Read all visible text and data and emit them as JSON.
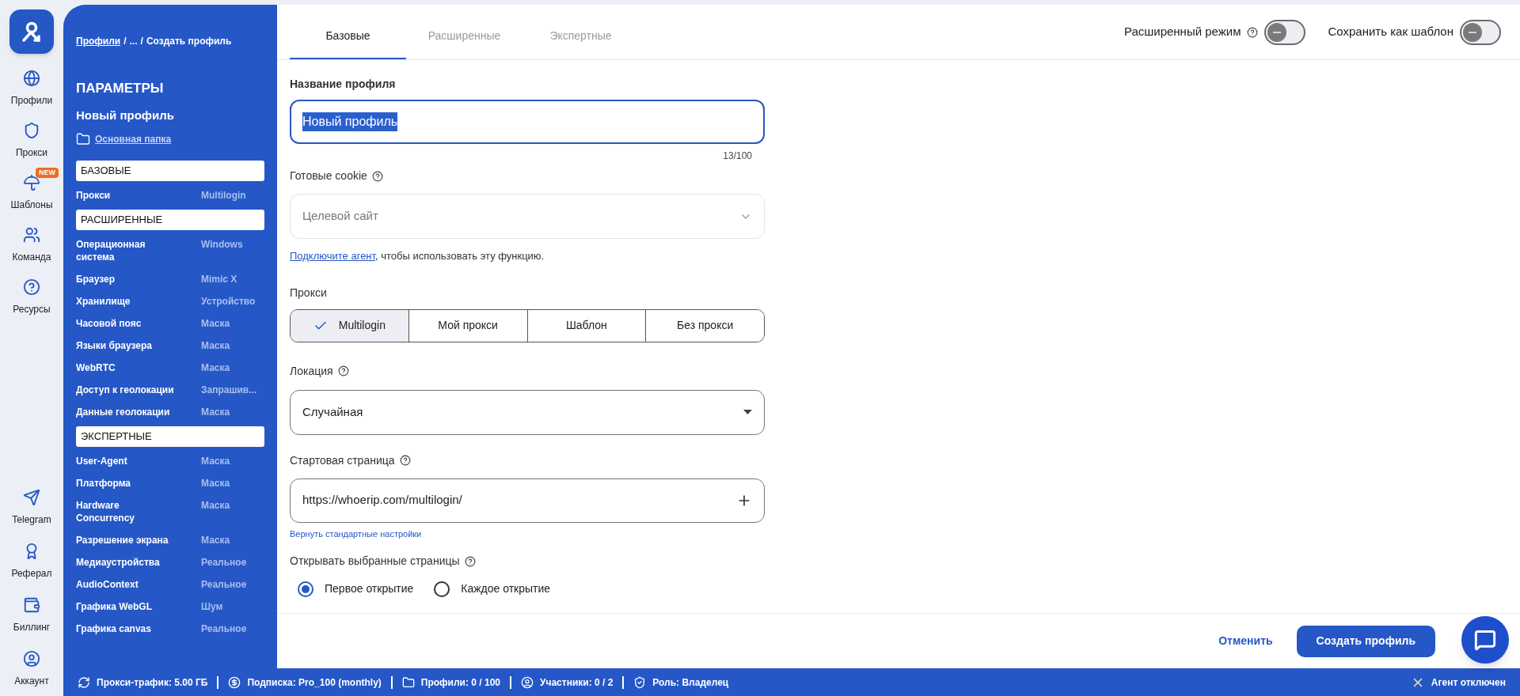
{
  "rail": {
    "items": [
      {
        "label": "Профили"
      },
      {
        "label": "Прокси"
      },
      {
        "label": "Шаблоны",
        "badge": "NEW"
      },
      {
        "label": "Команда"
      },
      {
        "label": "Ресурсы"
      }
    ],
    "bottom_items": [
      {
        "label": "Telegram"
      },
      {
        "label": "Реферал"
      },
      {
        "label": "Биллинг"
      },
      {
        "label": "Аккаунт"
      }
    ]
  },
  "sidebar": {
    "breadcrumb": {
      "separator": "/",
      "crumbs": [
        {
          "label": "Профили",
          "link": true
        },
        {
          "label": "...",
          "link": false
        },
        {
          "label": "Создать профиль",
          "link": false
        }
      ]
    },
    "title": "ПАРАМЕТРЫ",
    "profile_name": "Новый профиль",
    "folder": "Основная папка",
    "sections": [
      {
        "title": "БАЗОВЫЕ",
        "rows": [
          {
            "name": "Прокси",
            "value": "Multilogin"
          }
        ]
      },
      {
        "title": "РАСШИРЕННЫЕ",
        "rows": [
          {
            "name": "Операционная система",
            "value": "Windows"
          },
          {
            "name": "Браузер",
            "value": "Mimic X"
          },
          {
            "name": "Хранилище",
            "value": "Устройство"
          },
          {
            "name": "Часовой пояс",
            "value": "Маска"
          },
          {
            "name": "Языки браузера",
            "value": "Маска"
          },
          {
            "name": "WebRTC",
            "value": "Маска"
          },
          {
            "name": "Доступ к геолокации",
            "value": "Запрашив..."
          },
          {
            "name": "Данные геолокации",
            "value": "Маска"
          }
        ]
      },
      {
        "title": "ЭКСПЕРТНЫЕ",
        "rows": [
          {
            "name": "User-Agent",
            "value": "Маска"
          },
          {
            "name": "Платформа",
            "value": "Маска"
          },
          {
            "name": "Hardware Concurrency",
            "value": "Маска"
          },
          {
            "name": "Разрешение экрана",
            "value": "Маска"
          },
          {
            "name": "Медиаустройства",
            "value": "Реальное"
          },
          {
            "name": "AudioContext",
            "value": "Реальное"
          },
          {
            "name": "Графика WebGL",
            "value": "Шум"
          },
          {
            "name": "Графика canvas",
            "value": "Реальное"
          }
        ]
      }
    ]
  },
  "tabs": [
    {
      "label": "Базовые",
      "selected": true
    },
    {
      "label": "Расширенные",
      "selected": false
    },
    {
      "label": "Экспертные",
      "selected": false
    }
  ],
  "toggles": [
    {
      "label": "Расширенный режим",
      "help": true,
      "on": false
    },
    {
      "label": "Сохранить как шаблон",
      "help": false,
      "on": false
    }
  ],
  "form": {
    "name_field": {
      "label": "Название профиля",
      "value": "Новый профиль",
      "counter": "13/100"
    },
    "cookie": {
      "label": "Готовые cookie",
      "placeholder": "Целевой сайт"
    },
    "agent_note": {
      "link": "Подключите агент",
      "text": ", чтобы использовать эту функцию."
    },
    "proxy": {
      "label": "Прокси",
      "options": [
        {
          "label": "Multilogin",
          "selected": true
        },
        {
          "label": "Мой прокси",
          "selected": false
        },
        {
          "label": "Шаблон",
          "selected": false
        },
        {
          "label": "Без прокси",
          "selected": false
        }
      ]
    },
    "location": {
      "label": "Локация",
      "value": "Случайная"
    },
    "start_page": {
      "label": "Стартовая страница",
      "value": "https://whoerip.com/multilogin/",
      "reset": "Вернуть стандартные настройки"
    },
    "open_pages": {
      "label": "Открывать выбранные страницы",
      "options": [
        {
          "label": "Первое открытие",
          "selected": true
        },
        {
          "label": "Каждое открытие",
          "selected": false
        }
      ]
    }
  },
  "footer": {
    "cancel": "Отменить",
    "submit": "Создать профиль"
  },
  "status_bar": {
    "items": [
      {
        "text": "Прокси-трафик: 5.00 ГБ"
      },
      {
        "text": "Подписка: Pro_100 (monthly)"
      },
      {
        "text": "Профили: 0 / 100"
      },
      {
        "text": "Участники: 0 / 2"
      },
      {
        "text": "Роль: Владелец"
      }
    ],
    "agent": "Агент отключен"
  }
}
